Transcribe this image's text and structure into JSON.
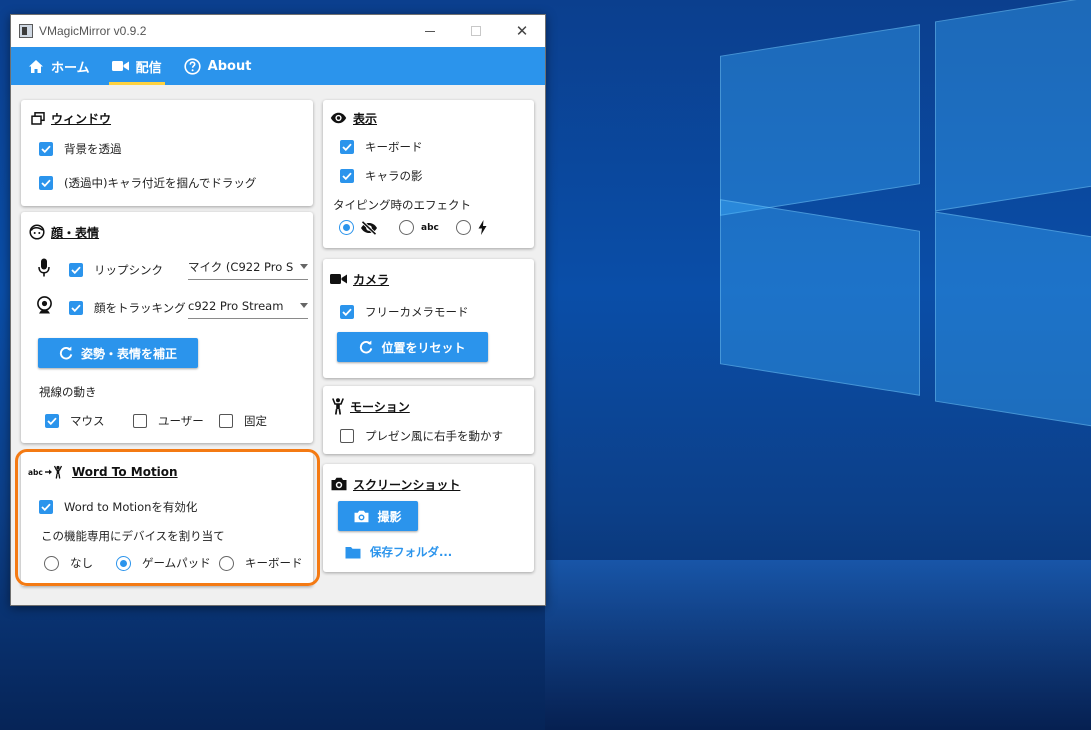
{
  "window": {
    "title": "VMagicMirror v0.9.2",
    "accent": "#2b94ec",
    "tab_underline": "#ffd23f",
    "highlight_color": "#f47a13"
  },
  "nav": {
    "tabs": [
      {
        "label": "ホーム",
        "icon": "home-icon",
        "active": false
      },
      {
        "label": "配信",
        "icon": "video-camera-icon",
        "active": true
      },
      {
        "label": "About",
        "icon": "help-circle-icon",
        "active": false
      }
    ]
  },
  "window_card": {
    "title": "ウィンドウ",
    "icon": "window-restore-icon",
    "transparent_label": "背景を透過",
    "transparent_checked": true,
    "drag_label": "(透過中)キャラ付近を掴んでドラッグ",
    "drag_checked": true
  },
  "face_card": {
    "title": "顔・表情",
    "icon": "face-icon",
    "lipsync_label": "リップシンク",
    "lipsync_checked": true,
    "lipsync_device": "マイク (C922 Pro S",
    "tracking_label": "顔をトラッキング",
    "tracking_checked": true,
    "tracking_device": "c922 Pro Stream",
    "calibrate_button": "姿勢・表情を補正",
    "gaze_label": "視線の動き",
    "gaze_options": [
      {
        "label": "マウス",
        "checked": true
      },
      {
        "label": "ユーザー",
        "checked": false
      },
      {
        "label": "固定",
        "checked": false
      }
    ]
  },
  "word_to_motion_card": {
    "title": "Word To Motion",
    "icon": "abc-to-motion-icon",
    "enable_label": "Word to Motionを有効化",
    "enable_checked": true,
    "device_label": "この機能専用にデバイスを割り当て",
    "device_options": [
      {
        "label": "なし",
        "selected": false
      },
      {
        "label": "ゲームパッド",
        "selected": true
      },
      {
        "label": "キーボード",
        "selected": false
      }
    ]
  },
  "display_card": {
    "title": "表示",
    "icon": "eye-icon",
    "keyboard_label": "キーボード",
    "keyboard_checked": true,
    "shadow_label": "キャラの影",
    "shadow_checked": true,
    "typing_effect_label": "タイピング時のエフェクト",
    "typing_effects": [
      {
        "icon": "eye-off-icon",
        "selected": true
      },
      {
        "label": "abc",
        "icon": "abc-icon",
        "selected": false
      },
      {
        "icon": "lightning-icon",
        "selected": false
      }
    ]
  },
  "camera_card": {
    "title": "カメラ",
    "icon": "video-camera-icon",
    "free_camera_label": "フリーカメラモード",
    "free_camera_checked": true,
    "reset_button": "位置をリセット"
  },
  "motion_card": {
    "title": "モーション",
    "icon": "person-raising-hands-icon",
    "presenter_label": "プレゼン風に右手を動かす",
    "presenter_checked": false
  },
  "screenshot_card": {
    "title": "スクリーンショット",
    "icon": "camera-icon",
    "shoot_button": "撮影",
    "folder_link": "保存フォルダ..."
  }
}
